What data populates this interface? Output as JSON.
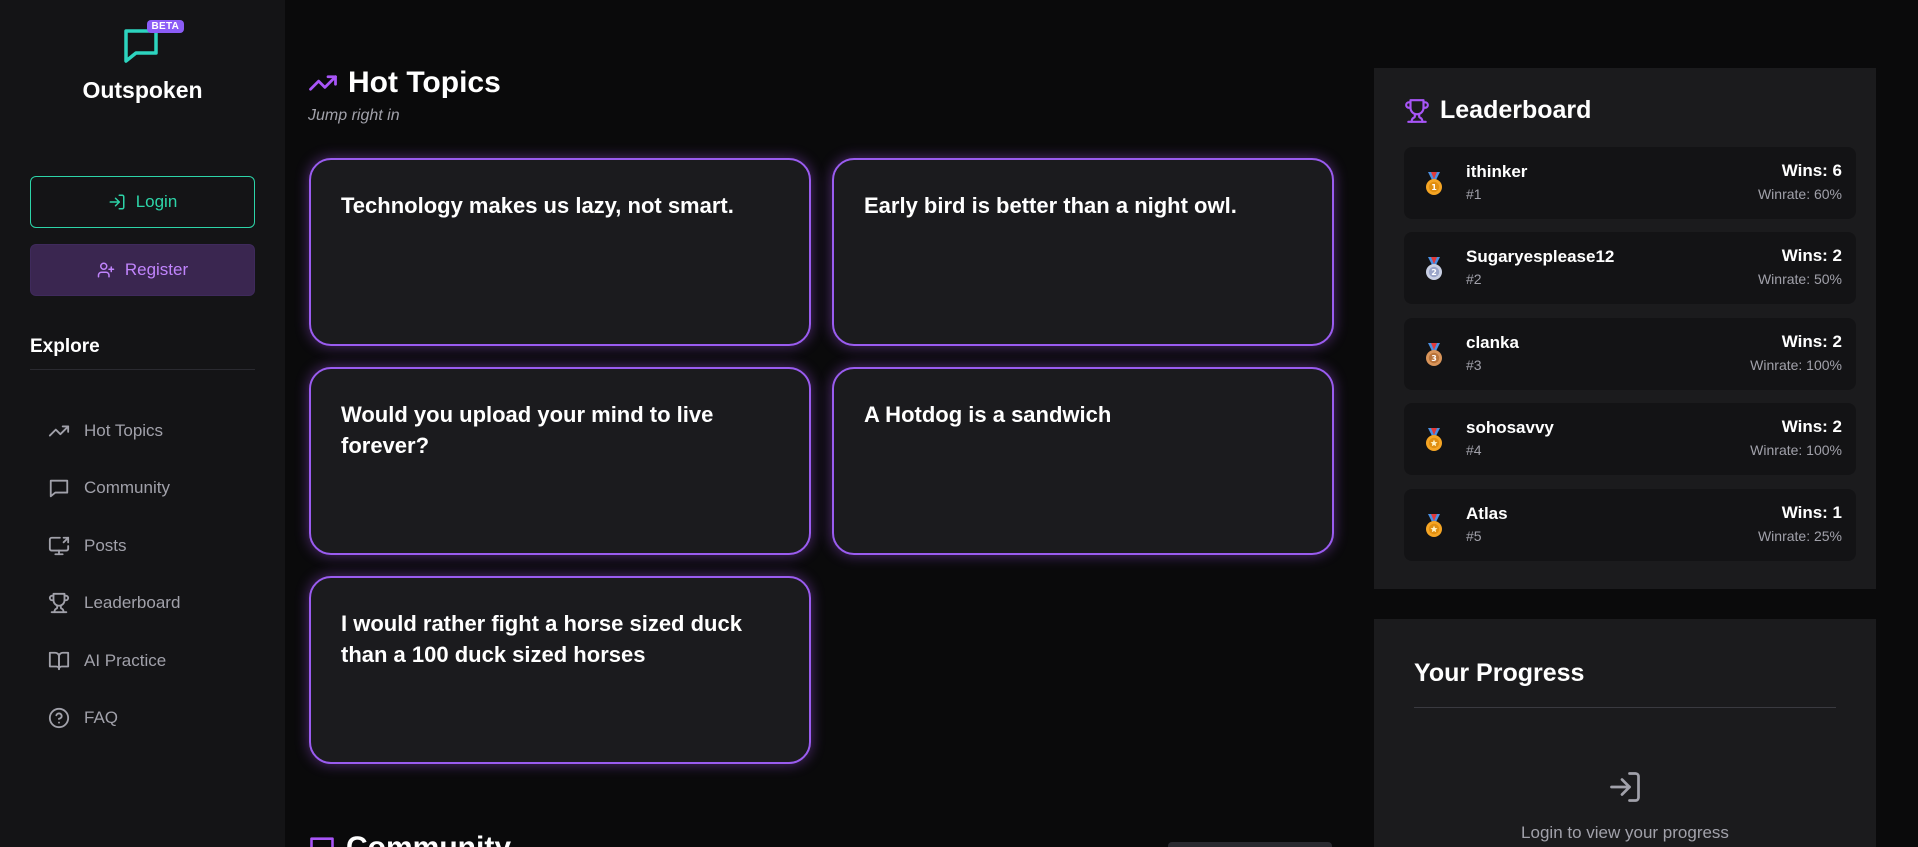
{
  "app": {
    "name": "Outspoken",
    "badge": "BETA"
  },
  "sidebar": {
    "login_label": "Login",
    "register_label": "Register",
    "section_title": "Explore",
    "items": [
      {
        "label": "Hot Topics",
        "icon": "trending-up-icon"
      },
      {
        "label": "Community",
        "icon": "chat-icon"
      },
      {
        "label": "Posts",
        "icon": "monitor-share-icon"
      },
      {
        "label": "Leaderboard",
        "icon": "trophy-icon"
      },
      {
        "label": "AI Practice",
        "icon": "book-icon"
      },
      {
        "label": "FAQ",
        "icon": "help-circle-icon"
      }
    ]
  },
  "main": {
    "hot_topics": {
      "title": "Hot Topics",
      "subtitle": "Jump right in",
      "topics": [
        "Technology makes us lazy, not smart.",
        "Early bird is better than a night owl.",
        "Would you upload your mind to live forever?",
        "A Hotdog is a sandwich",
        "I would rather fight a horse sized duck than a 100 duck sized horses"
      ]
    },
    "community": {
      "title": "Community"
    }
  },
  "leaderboard": {
    "title": "Leaderboard",
    "entries": [
      {
        "name": "ithinker",
        "rank": "#1",
        "wins": "Wins: 6",
        "winrate": "Winrate: 60%"
      },
      {
        "name": "Sugaryesplease12",
        "rank": "#2",
        "wins": "Wins: 2",
        "winrate": "Winrate: 50%"
      },
      {
        "name": "clanka",
        "rank": "#3",
        "wins": "Wins: 2",
        "winrate": "Winrate: 100%"
      },
      {
        "name": "sohosavvy",
        "rank": "#4",
        "wins": "Wins: 2",
        "winrate": "Winrate: 100%"
      },
      {
        "name": "Atlas",
        "rank": "#5",
        "wins": "Wins: 1",
        "winrate": "Winrate: 25%"
      }
    ]
  },
  "progress": {
    "title": "Your Progress",
    "message": "Login to view your progress"
  },
  "colors": {
    "accent_purple": "#a855f7",
    "accent_teal": "#2dd4a8",
    "medal_gold": "#f5a524",
    "medal_silver": "#9aa4c8",
    "medal_bronze": "#c8844a"
  }
}
